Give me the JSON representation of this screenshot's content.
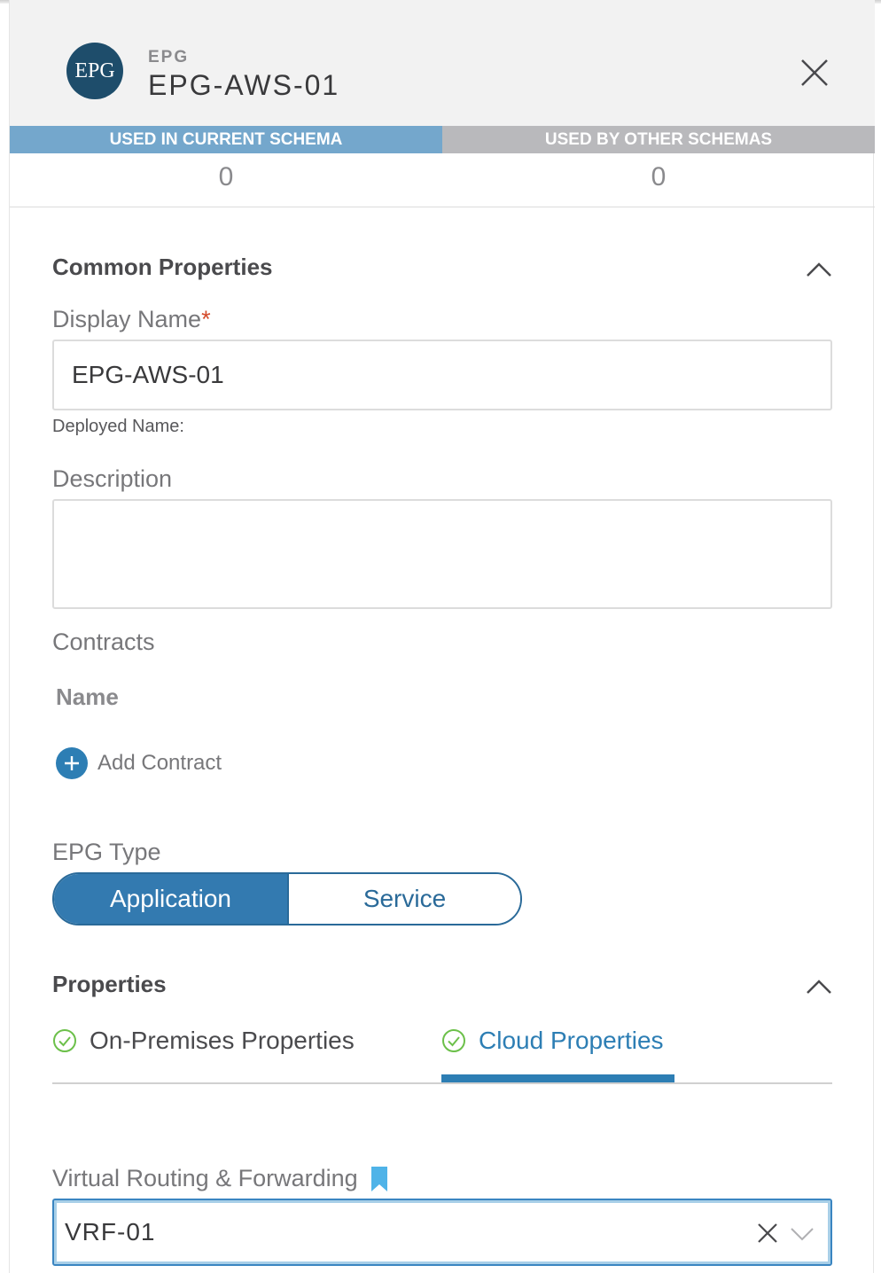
{
  "header": {
    "avatar_text": "EPG",
    "type_label": "EPG",
    "title": "EPG-AWS-01"
  },
  "usage": {
    "current_label": "USED IN CURRENT SCHEMA",
    "current_value": "0",
    "other_label": "USED BY OTHER SCHEMAS",
    "other_value": "0",
    "current_color": "#74a7cc",
    "other_color": "#b9b9bc"
  },
  "common": {
    "section_title": "Common Properties",
    "display_name_label": "Display Name",
    "required_mark": "*",
    "display_name_value": "EPG-AWS-01",
    "deployed_name_label": "Deployed Name:",
    "description_label": "Description",
    "description_value": "",
    "contracts_label": "Contracts",
    "contracts_col_name": "Name",
    "add_contract_label": "Add Contract",
    "epg_type_label": "EPG Type",
    "epg_type_options": [
      "Application",
      "Service"
    ],
    "epg_type_selected": "Application"
  },
  "properties": {
    "section_title": "Properties",
    "tabs": [
      {
        "label": "On-Premises Properties",
        "active": false
      },
      {
        "label": "Cloud Properties",
        "active": true
      }
    ],
    "vrf_label": "Virtual Routing & Forwarding",
    "vrf_value": "VRF-01"
  },
  "icons": {
    "close": "close-icon",
    "chevron_up": "chevron-up-icon",
    "plus": "plus-circle-icon",
    "check": "check-circle-icon",
    "bookmark": "bookmark-icon",
    "clear": "clear-icon",
    "dropdown": "chevron-down-icon"
  },
  "colors": {
    "accent": "#2d7eb4",
    "check_green": "#6cc04a",
    "bookmark_blue": "#4fb3e8",
    "required_red": "#d44a2a"
  }
}
